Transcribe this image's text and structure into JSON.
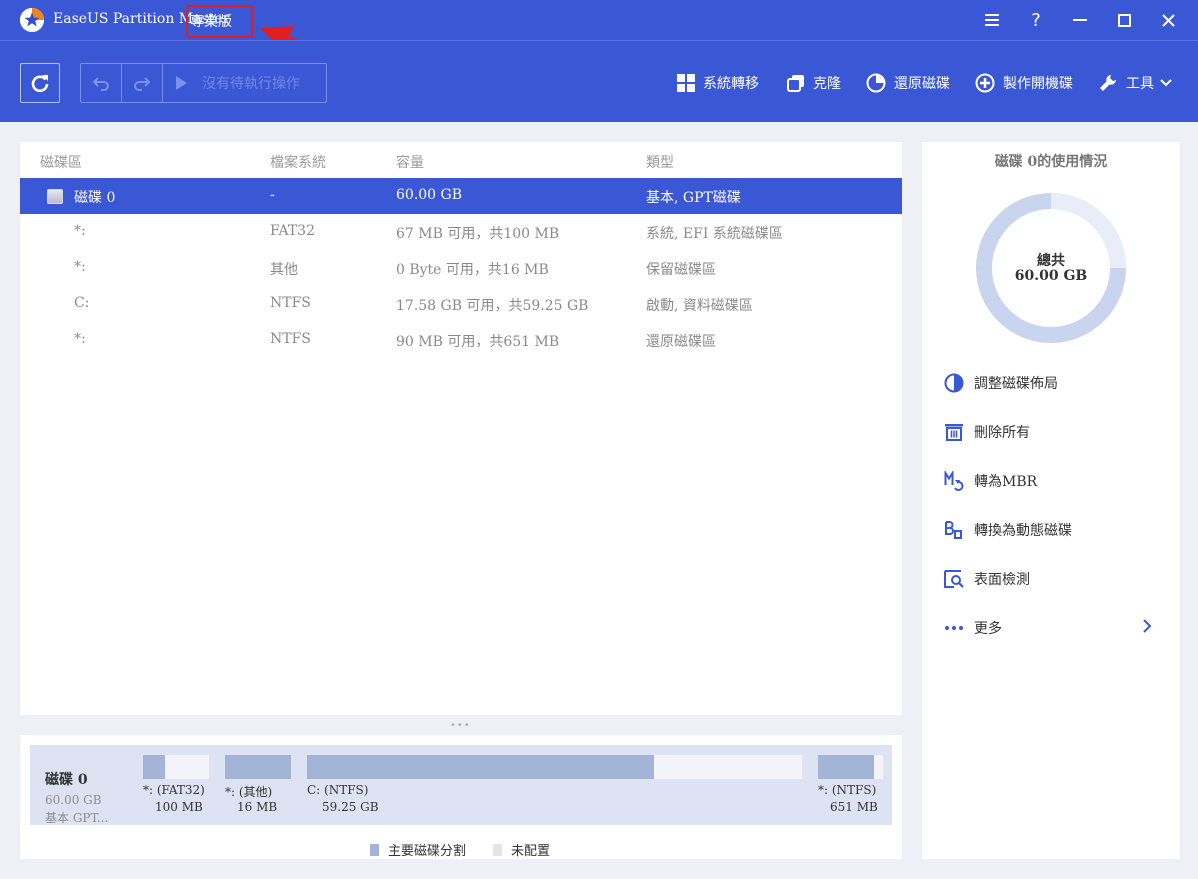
{
  "app": {
    "title": "EaseUS Partition Master",
    "edition": "專業版"
  },
  "toolbar": {
    "pending_label": "沒有待執行操作",
    "tools": [
      {
        "label": "系統轉移",
        "icon": "windows-icon"
      },
      {
        "label": "克隆",
        "icon": "clone-icon"
      },
      {
        "label": "還原磁碟",
        "icon": "restore-disk-icon"
      },
      {
        "label": "製作開機碟",
        "icon": "boot-disk-icon"
      },
      {
        "label": "工具",
        "icon": "wrench-icon"
      }
    ]
  },
  "table": {
    "columns": [
      "磁碟區",
      "檔案系統",
      "容量",
      "類型"
    ],
    "disk_row": {
      "name": "磁碟 0",
      "fs": "-",
      "capacity": "60.00 GB",
      "type": "基本, GPT磁碟"
    },
    "rows": [
      {
        "name": "*:",
        "fs": "FAT32",
        "capacity": "67 MB 可用，共100 MB",
        "type": "系統, EFI 系統磁碟區"
      },
      {
        "name": "*:",
        "fs": "其他",
        "capacity": "0 Byte 可用，共16 MB",
        "type": "保留磁碟區"
      },
      {
        "name": "C:",
        "fs": "NTFS",
        "capacity": "17.58 GB 可用，共59.25 GB",
        "type": "啟動, 資料磁碟區"
      },
      {
        "name": "*:",
        "fs": "NTFS",
        "capacity": "90 MB 可用，共651 MB",
        "type": "還原磁碟區"
      }
    ]
  },
  "disk_map": {
    "name": "磁碟 0",
    "size": "60.00 GB",
    "style": "基本 GPT...",
    "partitions": [
      {
        "label": "*: (FAT32)",
        "size": "100 MB",
        "used_fraction": 0.33
      },
      {
        "label": "*: (其他)",
        "size": "16 MB",
        "used_fraction": 1.0
      },
      {
        "label": "C: (NTFS)",
        "size": "59.25 GB",
        "used_fraction": 0.7
      },
      {
        "label": "*: (NTFS)",
        "size": "651 MB",
        "used_fraction": 0.86
      }
    ],
    "legend": [
      {
        "label": "主要磁碟分割",
        "color": "#a3b4d6"
      },
      {
        "label": "未配置",
        "color": "#e4e4e4"
      }
    ]
  },
  "side": {
    "title": "磁碟 0的使用情況",
    "total_label": "總共",
    "total_value": "60.00 GB",
    "actions": [
      {
        "label": "調整磁碟佈局",
        "icon": "pie-chart-icon"
      },
      {
        "label": "刪除所有",
        "icon": "trash-icon"
      },
      {
        "label": "轉為MBR",
        "icon": "convert-mbr-icon"
      },
      {
        "label": "轉換為動態磁碟",
        "icon": "convert-dynamic-icon"
      },
      {
        "label": "表面檢測",
        "icon": "surface-test-icon"
      },
      {
        "label": "更多",
        "icon": "more-icon"
      }
    ]
  },
  "colors": {
    "brand": "#3a57d6",
    "selected_row": "#3a57d6",
    "partition_fill": "#a3b4d6",
    "annotation_red": "#e02020"
  }
}
